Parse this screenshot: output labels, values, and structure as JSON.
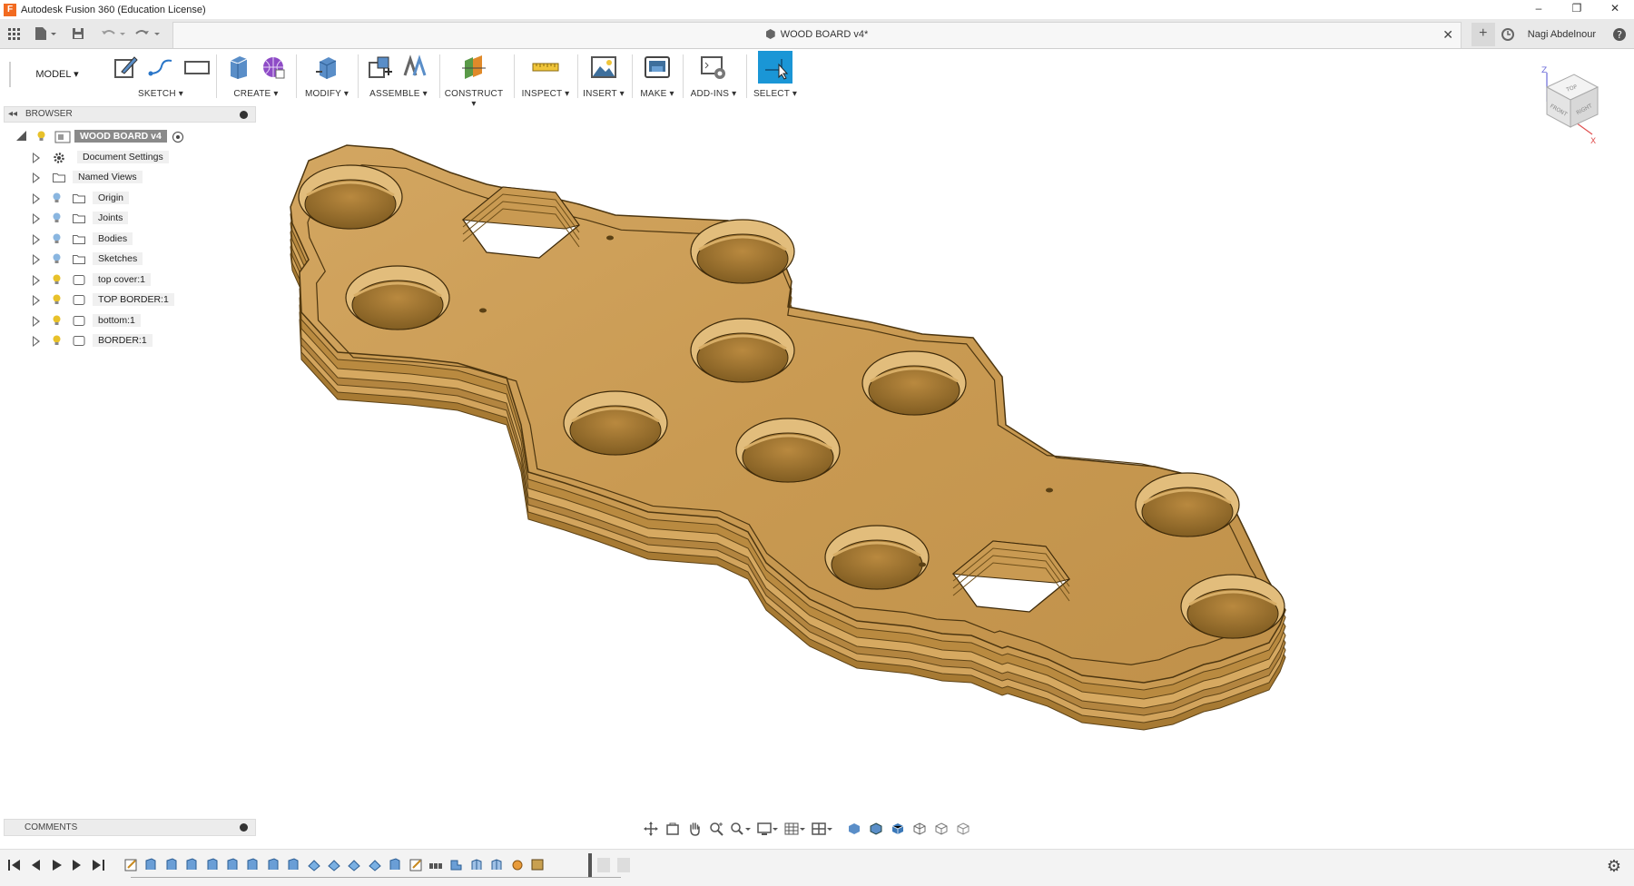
{
  "window": {
    "title": "Autodesk Fusion 360 (Education License)",
    "controls": [
      "–",
      "❐",
      "✕"
    ]
  },
  "document_tab": {
    "title": "WOOD BOARD v4*"
  },
  "user": {
    "name": "Nagi Abdelnour"
  },
  "toolbar": {
    "mode": "MODEL ▾",
    "groups": [
      {
        "label": "SKETCH ▾"
      },
      {
        "label": "CREATE ▾"
      },
      {
        "label": "MODIFY ▾"
      },
      {
        "label": "ASSEMBLE ▾"
      },
      {
        "label": "CONSTRUCT ▾"
      },
      {
        "label": "INSPECT ▾"
      },
      {
        "label": "INSERT ▾"
      },
      {
        "label": "MAKE ▾"
      },
      {
        "label": "ADD-INS ▾"
      },
      {
        "label": "SELECT ▾"
      }
    ],
    "accent_color": "#1a96d6"
  },
  "browser": {
    "title": "BROWSER",
    "root": "WOOD BOARD v4",
    "items": [
      {
        "label": "Document Settings",
        "icon": "gear-icon"
      },
      {
        "label": "Named Views",
        "icon": "folder-icon"
      },
      {
        "label": "Origin",
        "icon": "folder-icon"
      },
      {
        "label": "Joints",
        "icon": "folder-icon"
      },
      {
        "label": "Bodies",
        "icon": "folder-icon"
      },
      {
        "label": "Sketches",
        "icon": "folder-icon"
      },
      {
        "label": "top cover:1",
        "icon": "component-icon"
      },
      {
        "label": "TOP BORDER:1",
        "icon": "component-icon"
      },
      {
        "label": "bottom:1",
        "icon": "component-icon"
      },
      {
        "label": "BORDER:1",
        "icon": "component-icon"
      }
    ]
  },
  "viewcube": {
    "top": "TOP",
    "front": "FRONT",
    "right": "RIGHT",
    "axis_z": "Z",
    "axis_x": "X"
  },
  "comments": {
    "title": "COMMENTS"
  },
  "colors": {
    "wood_top": "#c99a52",
    "wood_edge": "#b98a40",
    "wood_dark": "#8a6526",
    "bulb": "#e8c12a"
  }
}
